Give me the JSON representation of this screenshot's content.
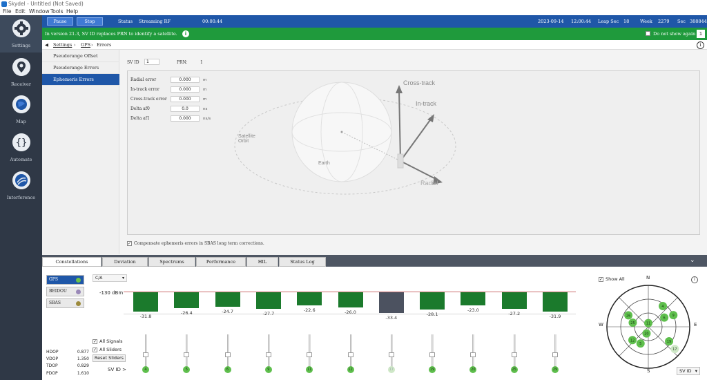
{
  "window": {
    "title": "Skydel - Untitled (Not Saved)"
  },
  "menu": [
    "File",
    "Edit",
    "Window",
    "Tools",
    "Help"
  ],
  "nav": [
    {
      "label": "Settings",
      "icon": "gear-icon",
      "active": true
    },
    {
      "label": "Receiver",
      "icon": "location-pin-icon",
      "active": false
    },
    {
      "label": "Map",
      "icon": "map-icon",
      "active": false
    },
    {
      "label": "Automate",
      "icon": "braces-icon",
      "active": false
    },
    {
      "label": "Interference",
      "icon": "signal-icon",
      "active": false
    }
  ],
  "statusbar": {
    "pause": "Pause",
    "stop": "Stop",
    "status_label": "Status",
    "status_value": "Streaming RF",
    "elapsed": "00:00:44",
    "date": "2023-09-14",
    "time": "12:00:44",
    "leap_label": "Leap Sec",
    "leap_value": "18",
    "week_label": "Week",
    "week_value": "2279",
    "sec_label": "Sec",
    "sec_value": "388844"
  },
  "notice": {
    "message": "In version 21.3, SV ID replaces PRN to identify a satellite.",
    "checkbox_label": "Do not show again",
    "count": "1"
  },
  "breadcrumb": [
    "Settings",
    "GPS",
    "Errors"
  ],
  "submenu": [
    "Pseudorange Offset",
    "Pseudorange Errors",
    "Ephemeris Errors"
  ],
  "ephemeris": {
    "sv_label": "SV ID",
    "sv_value": "1",
    "prn_label": "PRN:",
    "prn_value": "1",
    "fields": [
      {
        "label": "Radial error",
        "value": "0.000",
        "unit": "m"
      },
      {
        "label": "In-track error",
        "value": "0.000",
        "unit": "m"
      },
      {
        "label": "Cross-track error",
        "value": "0.000",
        "unit": "m"
      },
      {
        "label": "Delta af0",
        "value": "0.0",
        "unit": "ns"
      },
      {
        "label": "Delta af1",
        "value": "0.000",
        "unit": "ns/s"
      }
    ],
    "diagram": {
      "cross_track": "Cross-track",
      "in_track": "In-track",
      "radial": "Radial",
      "satellite_orbit": "Satellite Orbit",
      "earth": "Earth"
    },
    "compensate_label": "Compensate ephemeris errors in SBAS long term corrections."
  },
  "bottom_tabs": [
    "Constellations",
    "Deviation",
    "Spectrums",
    "Performance",
    "HIL",
    "Status Log"
  ],
  "constellations": {
    "systems": [
      {
        "name": "GPS",
        "color": "#6cc24a",
        "active": true
      },
      {
        "name": "BEIDOU",
        "color": "#9a89b8",
        "active": false
      },
      {
        "name": "SBAS",
        "color": "#9c8a3c",
        "active": false
      }
    ],
    "signal_select": "C/A",
    "ref_level": "-130 dBm",
    "dop": [
      {
        "name": "HDOP",
        "value": "0.877"
      },
      {
        "name": "VDOP",
        "value": "1.350"
      },
      {
        "name": "TDOP",
        "value": "0.829"
      },
      {
        "name": "PDOP",
        "value": "1.610"
      }
    ],
    "controls": {
      "all_signals": "All Signals",
      "all_sliders": "All Sliders",
      "reset_sliders": "Reset Sliders",
      "sv_id_label": "SV ID >"
    },
    "skyplot": {
      "show_all": "Show All",
      "n": "N",
      "e": "E",
      "s": "S",
      "w": "W",
      "sort_select": "SV ID"
    }
  },
  "chart_data": {
    "type": "bar",
    "title": "",
    "ylabel": "",
    "reference_label": "-130 dBm",
    "categories": [
      "4",
      "5",
      "6",
      "9",
      "11",
      "12",
      "17",
      "19",
      "20",
      "25",
      "29"
    ],
    "values": [
      -31.8,
      -26.4,
      -24.7,
      -27.7,
      -22.6,
      -26.0,
      -33.4,
      -28.1,
      -23.0,
      -27.2,
      -31.9
    ],
    "highlight": [
      false,
      false,
      false,
      false,
      false,
      false,
      true,
      false,
      false,
      false,
      false
    ],
    "colors": {
      "normal": "#1b7a2c",
      "highlight": "#4c5260"
    },
    "sky_positions": [
      {
        "sv": "26",
        "az": 300,
        "el": 40
      },
      {
        "sv": "4",
        "az": 35,
        "el": 35
      },
      {
        "sv": "6",
        "az": 60,
        "el": 50
      },
      {
        "sv": "25",
        "az": 285,
        "el": 55
      },
      {
        "sv": "11",
        "az": 0,
        "el": 82
      },
      {
        "sv": "9",
        "az": 65,
        "el": 30
      },
      {
        "sv": "12",
        "az": 230,
        "el": 45
      },
      {
        "sv": "20",
        "az": 195,
        "el": 75
      },
      {
        "sv": "5",
        "az": 205,
        "el": 50
      },
      {
        "sv": "19",
        "az": 125,
        "el": 35
      },
      {
        "sv": "17",
        "az": 130,
        "el": 15
      }
    ]
  }
}
